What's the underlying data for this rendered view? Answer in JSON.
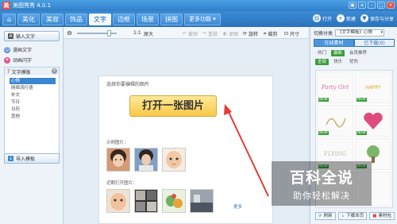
{
  "app": {
    "title": "美图秀秀 4.0.1",
    "logo_char": "美"
  },
  "tabs": [
    {
      "label": "⌂"
    },
    {
      "label": "美化"
    },
    {
      "label": "美容"
    },
    {
      "label": "饰品"
    },
    {
      "label": "文字"
    },
    {
      "label": "边框"
    },
    {
      "label": "场景"
    },
    {
      "label": "拼图"
    },
    {
      "label": "更多功能 ▾"
    }
  ],
  "right_tools": {
    "open": "打开",
    "new": "新建",
    "save_share": "保存与分享"
  },
  "left_panel": {
    "input_text": "输入文字",
    "comic_text": "漫画文字",
    "animated_text": "动画闪字",
    "template_title": "文字模板",
    "tree_items": [
      "心情",
      "网络流行语",
      "补文",
      "节日",
      "日历",
      "其他"
    ],
    "import_template": "导入模板"
  },
  "toolbar": {
    "zoom_level": "1:1",
    "original_size": "原大",
    "undo": "撤销",
    "redo": "重做",
    "reset": "原图",
    "rotate": "旋转",
    "crop": "裁剪",
    "size": "尺寸"
  },
  "canvas": {
    "select_label": "选择你要编辑的图片",
    "open_button": "打开一张图片",
    "sample_label": "示例图片：",
    "recent_label": "近期打开图片：",
    "more_link": "更多"
  },
  "right_panel": {
    "switch_label": "切换分类",
    "category_value": "《文字模板》心情",
    "tab_online": "在线素材",
    "tab_downloaded": "已下载(0)",
    "chips_row1": [
      "热门",
      "最新",
      "会员推荐"
    ],
    "chips_row2": [
      "全部",
      "快乐",
      "忧伤"
    ],
    "cell_texts": [
      "Party Girl",
      "HAPPY",
      "",
      "",
      "FLYING",
      ""
    ],
    "new_badge": "NEW",
    "btn_refresh": "刷新",
    "btn_download": "下载本页",
    "btn_material": "素材包"
  },
  "watermark": {
    "big": "百科全说",
    "small": "助你轻松解决"
  },
  "colors": {
    "accent": "#2f7fc9",
    "button_yellow": "#f8c94a",
    "arrow_red": "#e53935",
    "chip_green": "#3a9d3a"
  }
}
